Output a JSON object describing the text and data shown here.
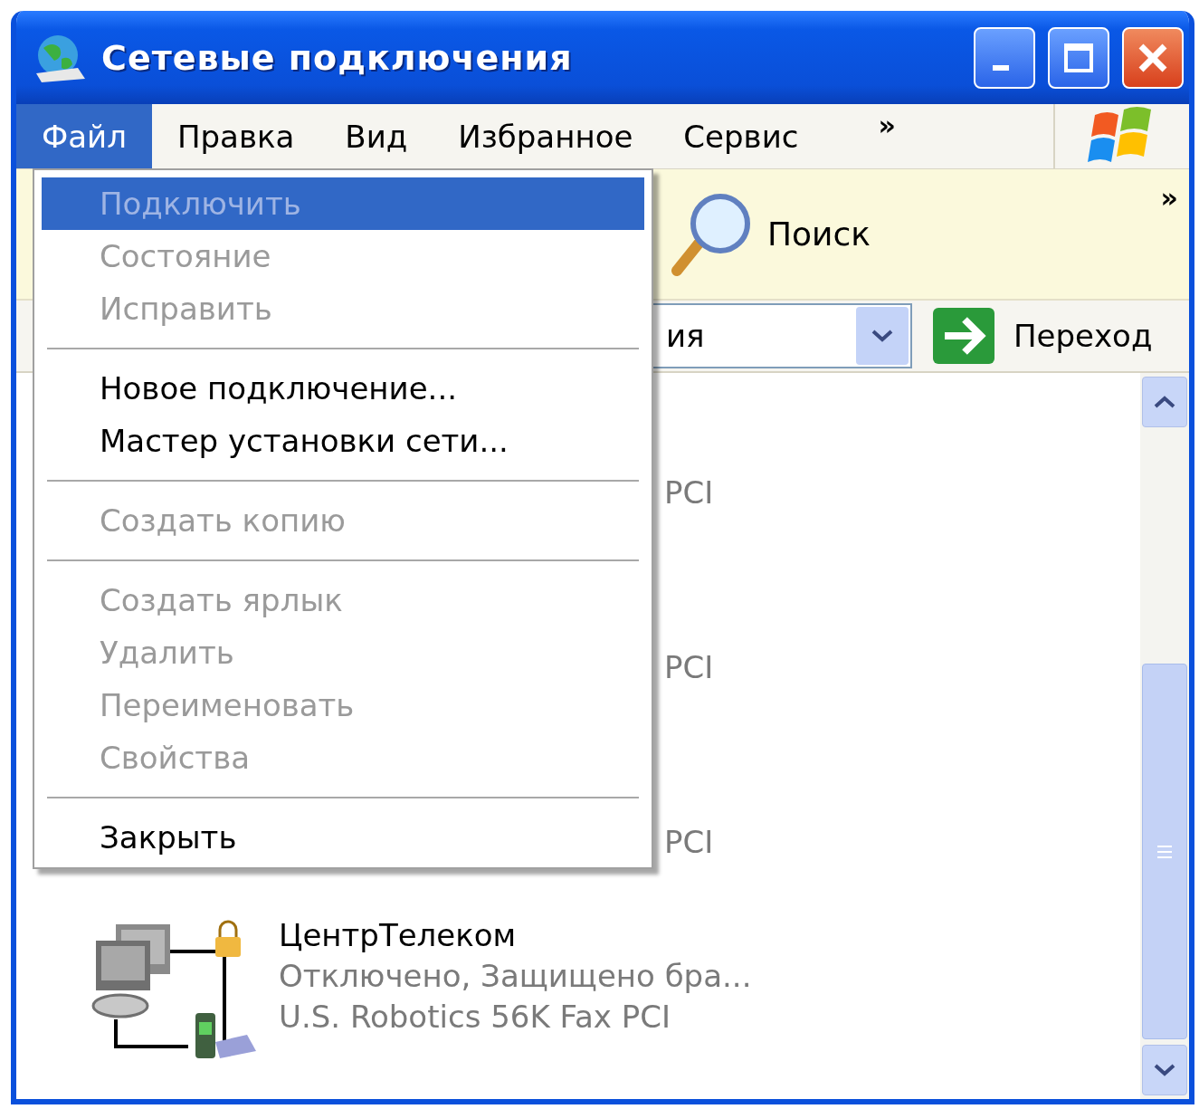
{
  "window": {
    "title": "Сетевые подключения"
  },
  "menu_bar": {
    "items": [
      {
        "label": "Файл",
        "selected": true
      },
      {
        "label": "Правка",
        "selected": false
      },
      {
        "label": "Вид",
        "selected": false
      },
      {
        "label": "Избранное",
        "selected": false
      },
      {
        "label": "Сервис",
        "selected": false
      }
    ],
    "overflow": "»"
  },
  "toolbar": {
    "search_label": "Поиск",
    "overflow": "»"
  },
  "address_bar": {
    "value": "ия",
    "go_label": "Переход"
  },
  "connections": [
    {
      "kind": "partial",
      "device": "PCI"
    },
    {
      "kind": "partial",
      "device": "PCI"
    },
    {
      "kind": "partial",
      "device": "PCI"
    },
    {
      "kind": "full",
      "name": "ЦентрТелеком",
      "status": "Отключено, Защищено бра...",
      "device": "U.S. Robotics 56K Fax PCI"
    }
  ],
  "file_menu": [
    {
      "kind": "item",
      "label": "Подключить",
      "disabled": true,
      "selected": true
    },
    {
      "kind": "item",
      "label": "Состояние",
      "disabled": true,
      "selected": false
    },
    {
      "kind": "item",
      "label": "Исправить",
      "disabled": true,
      "selected": false
    },
    {
      "kind": "separator"
    },
    {
      "kind": "item",
      "label": "Новое подключение...",
      "disabled": false,
      "selected": false
    },
    {
      "kind": "item",
      "label": "Мастер установки сети...",
      "disabled": false,
      "selected": false
    },
    {
      "kind": "separator"
    },
    {
      "kind": "item",
      "label": "Создать копию",
      "disabled": true,
      "selected": false
    },
    {
      "kind": "separator"
    },
    {
      "kind": "item",
      "label": "Создать ярлык",
      "disabled": true,
      "selected": false
    },
    {
      "kind": "item",
      "label": "Удалить",
      "disabled": true,
      "selected": false
    },
    {
      "kind": "item",
      "label": "Переименовать",
      "disabled": true,
      "selected": false
    },
    {
      "kind": "item",
      "label": "Свойства",
      "disabled": true,
      "selected": false
    },
    {
      "kind": "separator"
    },
    {
      "kind": "item",
      "label": "Закрыть",
      "disabled": false,
      "selected": false
    }
  ]
}
